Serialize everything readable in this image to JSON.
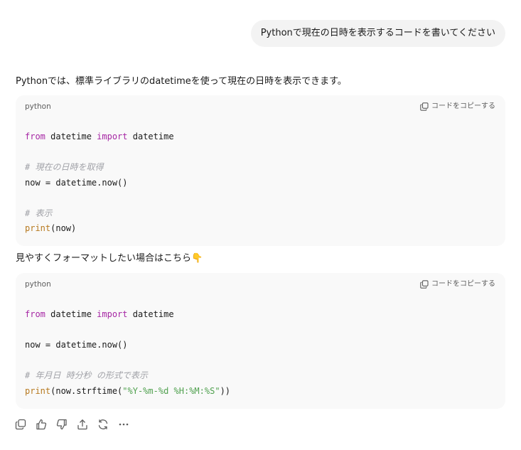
{
  "user_message": "Pythonで現在の日時を表示するコードを書いてください",
  "assistant": {
    "intro": "Pythonでは、標準ライブラリのdatetimeを使って現在の日時を表示できます。",
    "mid_text": "見やすくフォーマットしたい場合はこちら",
    "mid_emoji": "👇",
    "code_blocks": [
      {
        "language": "python",
        "copy_label": "コードをコピーする",
        "lines": {
          "l1_kw1": "from",
          "l1_mod": " datetime ",
          "l1_kw2": "import",
          "l1_name": " datetime",
          "l3_comment": "# 現在の日時を取得",
          "l4_code": "now = datetime.now()",
          "l6_comment": "# 表示",
          "l7_fn": "print",
          "l7_rest": "(now)"
        }
      },
      {
        "language": "python",
        "copy_label": "コードをコピーする",
        "lines": {
          "l1_kw1": "from",
          "l1_mod": " datetime ",
          "l1_kw2": "import",
          "l1_name": " datetime",
          "l3_code": "now = datetime.now()",
          "l5_comment": "# 年月日 時分秒 の形式で表示",
          "l6_fn": "print",
          "l6_pre": "(now.strftime(",
          "l6_str": "\"%Y-%m-%d %H:%M:%S\"",
          "l6_post": "))"
        }
      }
    ]
  },
  "action_icons": [
    "copy-icon",
    "thumbs-up-icon",
    "thumbs-down-icon",
    "share-icon",
    "regenerate-icon",
    "more-icon"
  ]
}
